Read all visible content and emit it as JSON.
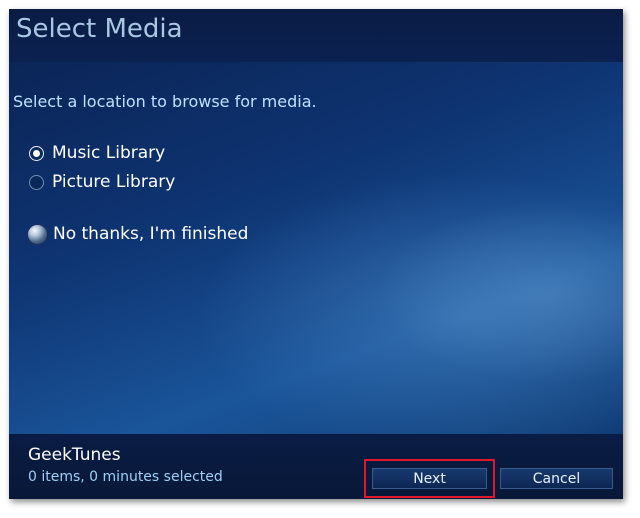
{
  "window": {
    "title": "Select Media"
  },
  "main": {
    "instruction": "Select a location to browse for media.",
    "options": [
      {
        "label": "Music Library",
        "selected": true
      },
      {
        "label": "Picture Library",
        "selected": false
      }
    ],
    "finish_option": "No thanks, I'm finished"
  },
  "footer": {
    "app_name": "GeekTunes",
    "status": "0 items, 0 minutes selected",
    "next_label": "Next",
    "cancel_label": "Cancel"
  },
  "colors": {
    "highlight": "#e0192a",
    "title_text": "#a9c7e2",
    "instruction_text": "#bfe0ff"
  }
}
